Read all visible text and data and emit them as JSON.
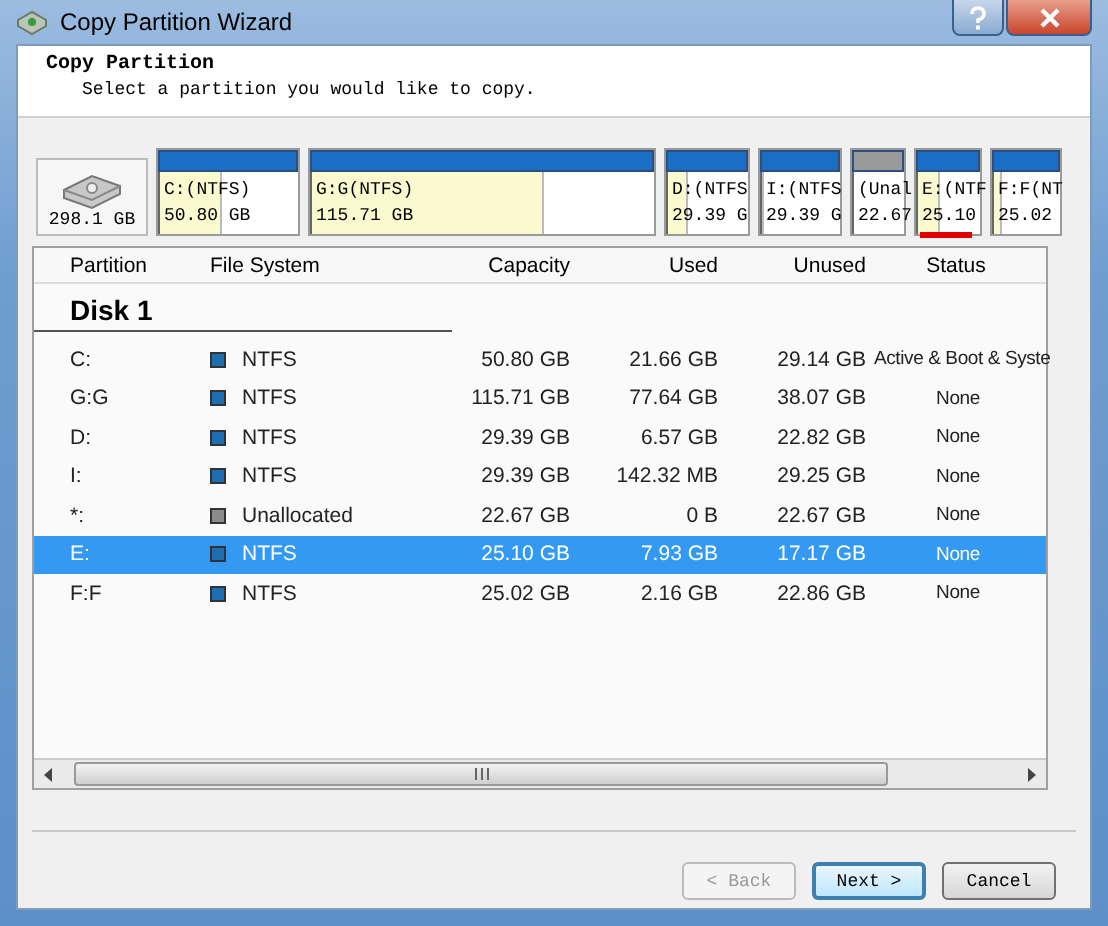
{
  "window": {
    "title": "Copy Partition Wizard"
  },
  "header": {
    "title": "Copy Partition",
    "subtitle": "Select a partition you would like to copy."
  },
  "disk_map": {
    "disk_size": "298.1 GB",
    "partitions": [
      {
        "label": "C:(NTFS)",
        "size": "50.80 GB",
        "kind": "ntfs",
        "level": 0.43,
        "selected": false
      },
      {
        "label": "G:G(NTFS)",
        "size": "115.71 GB",
        "kind": "ntfs",
        "level": 0.67,
        "selected": false
      },
      {
        "label": "D:(NTFS",
        "size": "29.39 G",
        "kind": "ntfs",
        "level": 0.22,
        "selected": false
      },
      {
        "label": "I:(NTFS",
        "size": "29.39 G",
        "kind": "ntfs",
        "level": 0.01,
        "selected": false
      },
      {
        "label": "(Unal",
        "size": "22.67",
        "kind": "unallocated",
        "selected": false
      },
      {
        "label": "E:(NTF",
        "size": "25.10",
        "kind": "ntfs",
        "level": 0.32,
        "selected": true
      },
      {
        "label": "F:F(NT",
        "size": "25.02",
        "kind": "ntfs",
        "level": 0.09,
        "selected": false
      }
    ]
  },
  "table": {
    "columns": [
      "Partition",
      "File System",
      "Capacity",
      "Used",
      "Unused",
      "Status"
    ],
    "group": "Disk 1",
    "rows": [
      {
        "partition": "C:",
        "file_system": "NTFS",
        "color": "#1e6eb4",
        "capacity": "50.80 GB",
        "used": "21.66 GB",
        "unused": "29.14 GB",
        "status": "Active & Boot & Syste",
        "selected": false
      },
      {
        "partition": "G:G",
        "file_system": "NTFS",
        "color": "#1e6eb4",
        "capacity": "115.71 GB",
        "used": "77.64 GB",
        "unused": "38.07 GB",
        "status": "None",
        "selected": false
      },
      {
        "partition": "D:",
        "file_system": "NTFS",
        "color": "#1e6eb4",
        "capacity": "29.39 GB",
        "used": "6.57 GB",
        "unused": "22.82 GB",
        "status": "None",
        "selected": false
      },
      {
        "partition": "I:",
        "file_system": "NTFS",
        "color": "#1e6eb4",
        "capacity": "29.39 GB",
        "used": "142.32 MB",
        "unused": "29.25 GB",
        "status": "None",
        "selected": false
      },
      {
        "partition": "*:",
        "file_system": "Unallocated",
        "color": "#8c8c8c",
        "capacity": "22.67 GB",
        "used": "0 B",
        "unused": "22.67 GB",
        "status": "None",
        "selected": false
      },
      {
        "partition": "E:",
        "file_system": "NTFS",
        "color": "#1e6eb4",
        "capacity": "25.10 GB",
        "used": "7.93 GB",
        "unused": "17.17 GB",
        "status": "None",
        "selected": true
      },
      {
        "partition": "F:F",
        "file_system": "NTFS",
        "color": "#1e6eb4",
        "capacity": "25.02 GB",
        "used": "2.16 GB",
        "unused": "22.86 GB",
        "status": "None",
        "selected": false
      }
    ]
  },
  "buttons": [
    {
      "label": "< Back",
      "disabled": true,
      "default": false
    },
    {
      "label": "Next >",
      "disabled": false,
      "default": true
    },
    {
      "label": "Cancel",
      "disabled": false,
      "default": false
    }
  ]
}
